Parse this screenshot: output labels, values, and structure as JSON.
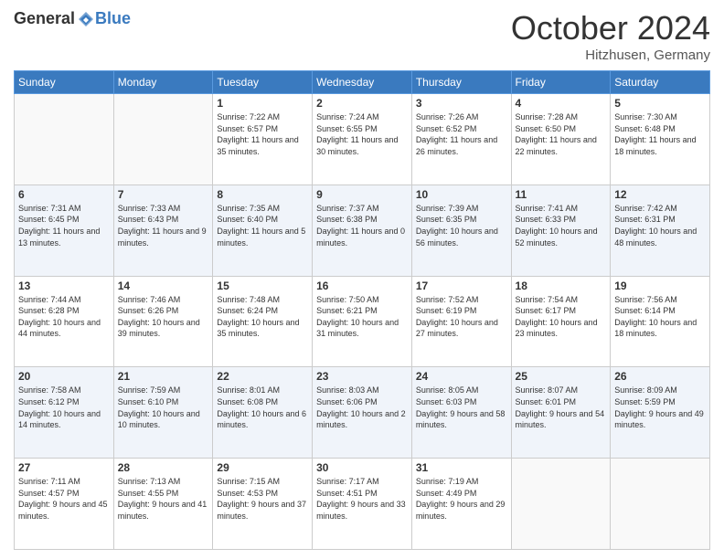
{
  "logo": {
    "general": "General",
    "blue": "Blue"
  },
  "title": "October 2024",
  "subtitle": "Hitzhusen, Germany",
  "days_of_week": [
    "Sunday",
    "Monday",
    "Tuesday",
    "Wednesday",
    "Thursday",
    "Friday",
    "Saturday"
  ],
  "weeks": [
    [
      {
        "day": "",
        "sunrise": "",
        "sunset": "",
        "daylight": ""
      },
      {
        "day": "",
        "sunrise": "",
        "sunset": "",
        "daylight": ""
      },
      {
        "day": "1",
        "sunrise": "Sunrise: 7:22 AM",
        "sunset": "Sunset: 6:57 PM",
        "daylight": "Daylight: 11 hours and 35 minutes."
      },
      {
        "day": "2",
        "sunrise": "Sunrise: 7:24 AM",
        "sunset": "Sunset: 6:55 PM",
        "daylight": "Daylight: 11 hours and 30 minutes."
      },
      {
        "day": "3",
        "sunrise": "Sunrise: 7:26 AM",
        "sunset": "Sunset: 6:52 PM",
        "daylight": "Daylight: 11 hours and 26 minutes."
      },
      {
        "day": "4",
        "sunrise": "Sunrise: 7:28 AM",
        "sunset": "Sunset: 6:50 PM",
        "daylight": "Daylight: 11 hours and 22 minutes."
      },
      {
        "day": "5",
        "sunrise": "Sunrise: 7:30 AM",
        "sunset": "Sunset: 6:48 PM",
        "daylight": "Daylight: 11 hours and 18 minutes."
      }
    ],
    [
      {
        "day": "6",
        "sunrise": "Sunrise: 7:31 AM",
        "sunset": "Sunset: 6:45 PM",
        "daylight": "Daylight: 11 hours and 13 minutes."
      },
      {
        "day": "7",
        "sunrise": "Sunrise: 7:33 AM",
        "sunset": "Sunset: 6:43 PM",
        "daylight": "Daylight: 11 hours and 9 minutes."
      },
      {
        "day": "8",
        "sunrise": "Sunrise: 7:35 AM",
        "sunset": "Sunset: 6:40 PM",
        "daylight": "Daylight: 11 hours and 5 minutes."
      },
      {
        "day": "9",
        "sunrise": "Sunrise: 7:37 AM",
        "sunset": "Sunset: 6:38 PM",
        "daylight": "Daylight: 11 hours and 0 minutes."
      },
      {
        "day": "10",
        "sunrise": "Sunrise: 7:39 AM",
        "sunset": "Sunset: 6:35 PM",
        "daylight": "Daylight: 10 hours and 56 minutes."
      },
      {
        "day": "11",
        "sunrise": "Sunrise: 7:41 AM",
        "sunset": "Sunset: 6:33 PM",
        "daylight": "Daylight: 10 hours and 52 minutes."
      },
      {
        "day": "12",
        "sunrise": "Sunrise: 7:42 AM",
        "sunset": "Sunset: 6:31 PM",
        "daylight": "Daylight: 10 hours and 48 minutes."
      }
    ],
    [
      {
        "day": "13",
        "sunrise": "Sunrise: 7:44 AM",
        "sunset": "Sunset: 6:28 PM",
        "daylight": "Daylight: 10 hours and 44 minutes."
      },
      {
        "day": "14",
        "sunrise": "Sunrise: 7:46 AM",
        "sunset": "Sunset: 6:26 PM",
        "daylight": "Daylight: 10 hours and 39 minutes."
      },
      {
        "day": "15",
        "sunrise": "Sunrise: 7:48 AM",
        "sunset": "Sunset: 6:24 PM",
        "daylight": "Daylight: 10 hours and 35 minutes."
      },
      {
        "day": "16",
        "sunrise": "Sunrise: 7:50 AM",
        "sunset": "Sunset: 6:21 PM",
        "daylight": "Daylight: 10 hours and 31 minutes."
      },
      {
        "day": "17",
        "sunrise": "Sunrise: 7:52 AM",
        "sunset": "Sunset: 6:19 PM",
        "daylight": "Daylight: 10 hours and 27 minutes."
      },
      {
        "day": "18",
        "sunrise": "Sunrise: 7:54 AM",
        "sunset": "Sunset: 6:17 PM",
        "daylight": "Daylight: 10 hours and 23 minutes."
      },
      {
        "day": "19",
        "sunrise": "Sunrise: 7:56 AM",
        "sunset": "Sunset: 6:14 PM",
        "daylight": "Daylight: 10 hours and 18 minutes."
      }
    ],
    [
      {
        "day": "20",
        "sunrise": "Sunrise: 7:58 AM",
        "sunset": "Sunset: 6:12 PM",
        "daylight": "Daylight: 10 hours and 14 minutes."
      },
      {
        "day": "21",
        "sunrise": "Sunrise: 7:59 AM",
        "sunset": "Sunset: 6:10 PM",
        "daylight": "Daylight: 10 hours and 10 minutes."
      },
      {
        "day": "22",
        "sunrise": "Sunrise: 8:01 AM",
        "sunset": "Sunset: 6:08 PM",
        "daylight": "Daylight: 10 hours and 6 minutes."
      },
      {
        "day": "23",
        "sunrise": "Sunrise: 8:03 AM",
        "sunset": "Sunset: 6:06 PM",
        "daylight": "Daylight: 10 hours and 2 minutes."
      },
      {
        "day": "24",
        "sunrise": "Sunrise: 8:05 AM",
        "sunset": "Sunset: 6:03 PM",
        "daylight": "Daylight: 9 hours and 58 minutes."
      },
      {
        "day": "25",
        "sunrise": "Sunrise: 8:07 AM",
        "sunset": "Sunset: 6:01 PM",
        "daylight": "Daylight: 9 hours and 54 minutes."
      },
      {
        "day": "26",
        "sunrise": "Sunrise: 8:09 AM",
        "sunset": "Sunset: 5:59 PM",
        "daylight": "Daylight: 9 hours and 49 minutes."
      }
    ],
    [
      {
        "day": "27",
        "sunrise": "Sunrise: 7:11 AM",
        "sunset": "Sunset: 4:57 PM",
        "daylight": "Daylight: 9 hours and 45 minutes."
      },
      {
        "day": "28",
        "sunrise": "Sunrise: 7:13 AM",
        "sunset": "Sunset: 4:55 PM",
        "daylight": "Daylight: 9 hours and 41 minutes."
      },
      {
        "day": "29",
        "sunrise": "Sunrise: 7:15 AM",
        "sunset": "Sunset: 4:53 PM",
        "daylight": "Daylight: 9 hours and 37 minutes."
      },
      {
        "day": "30",
        "sunrise": "Sunrise: 7:17 AM",
        "sunset": "Sunset: 4:51 PM",
        "daylight": "Daylight: 9 hours and 33 minutes."
      },
      {
        "day": "31",
        "sunrise": "Sunrise: 7:19 AM",
        "sunset": "Sunset: 4:49 PM",
        "daylight": "Daylight: 9 hours and 29 minutes."
      },
      {
        "day": "",
        "sunrise": "",
        "sunset": "",
        "daylight": ""
      },
      {
        "day": "",
        "sunrise": "",
        "sunset": "",
        "daylight": ""
      }
    ]
  ]
}
